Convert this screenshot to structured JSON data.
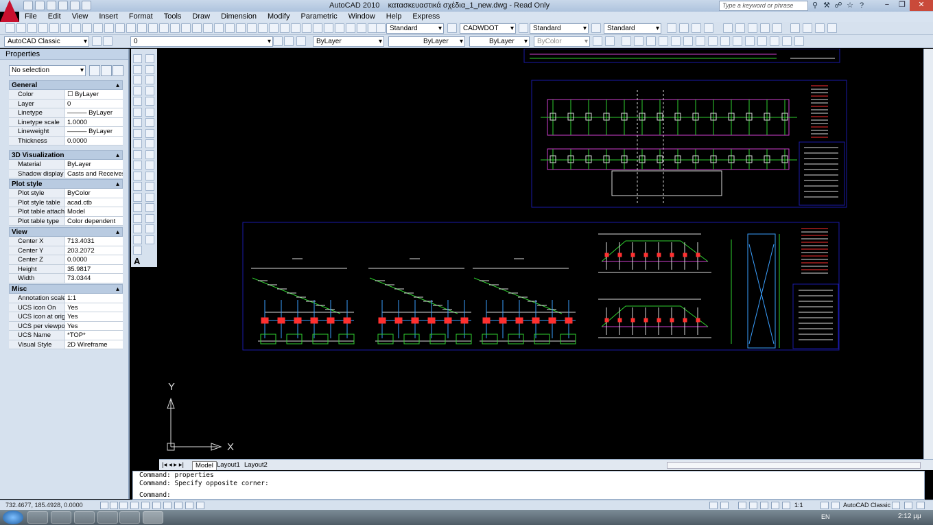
{
  "window": {
    "app": "AutoCAD 2010",
    "file": "κατασκευαστικά σχέδια_1_new.dwg - Read Only",
    "search_placeholder": "Type a keyword or phrase",
    "min": "−",
    "max": "❐",
    "close": "✕"
  },
  "menu": [
    "File",
    "Edit",
    "View",
    "Insert",
    "Format",
    "Tools",
    "Draw",
    "Dimension",
    "Modify",
    "Parametric",
    "Window",
    "Help",
    "Express"
  ],
  "toolbar1": {
    "text_style": "Standard",
    "dim_style": "CADWDOT",
    "table_style": "Standard",
    "mleader_style": "Standard"
  },
  "toolbar2": {
    "workspace": "AutoCAD Classic",
    "layer": "0",
    "color": "ByLayer",
    "linetype": "ByLayer",
    "lineweight": "ByLayer",
    "plotstyle": "ByColor"
  },
  "properties": {
    "title": "Properties",
    "selection": "No selection",
    "sections": [
      {
        "name": "General",
        "rows": [
          [
            "Color",
            "☐ ByLayer"
          ],
          [
            "Layer",
            "0"
          ],
          [
            "Linetype",
            "——— ByLayer"
          ],
          [
            "Linetype scale",
            "1.0000"
          ],
          [
            "Lineweight",
            "——— ByLayer"
          ],
          [
            "Thickness",
            "0.0000"
          ]
        ]
      },
      {
        "name": "3D Visualization",
        "rows": [
          [
            "Material",
            "ByLayer"
          ],
          [
            "Shadow display",
            "Casts and Receives ..."
          ]
        ]
      },
      {
        "name": "Plot style",
        "rows": [
          [
            "Plot style",
            "ByColor"
          ],
          [
            "Plot style table",
            "acad.ctb"
          ],
          [
            "Plot table attach...",
            "Model"
          ],
          [
            "Plot table type",
            "Color dependent"
          ]
        ]
      },
      {
        "name": "View",
        "rows": [
          [
            "Center X",
            "713.4031"
          ],
          [
            "Center Y",
            "203.2072"
          ],
          [
            "Center Z",
            "0.0000"
          ],
          [
            "Height",
            "35.9817"
          ],
          [
            "Width",
            "73.0344"
          ]
        ]
      },
      {
        "name": "Misc",
        "rows": [
          [
            "Annotation scale",
            "1:1"
          ],
          [
            "UCS icon On",
            "Yes"
          ],
          [
            "UCS icon at origin",
            "Yes"
          ],
          [
            "UCS per viewport",
            "Yes"
          ],
          [
            "UCS Name",
            "*TOP*"
          ],
          [
            "Visual Style",
            "2D Wireframe"
          ]
        ]
      }
    ]
  },
  "canvas": {
    "ucs_y": "Y",
    "ucs_x": "X",
    "text_tool": "A"
  },
  "layout_tabs": [
    "Model",
    "Layout1",
    "Layout2"
  ],
  "command": {
    "line1": "Command: properties",
    "line2": "Command: Specify opposite corner:",
    "prompt": "Command:"
  },
  "status": {
    "coords": "732.4677, 185.4928, 0.0000",
    "scale": "1:1",
    "workspace": "AutoCAD Classic"
  },
  "taskbar": {
    "lang": "EN",
    "clock": "2:12 μμ"
  },
  "colors": {
    "accent": "#c8102e",
    "canvas": "#000000",
    "ui": "#d6e1ee"
  }
}
